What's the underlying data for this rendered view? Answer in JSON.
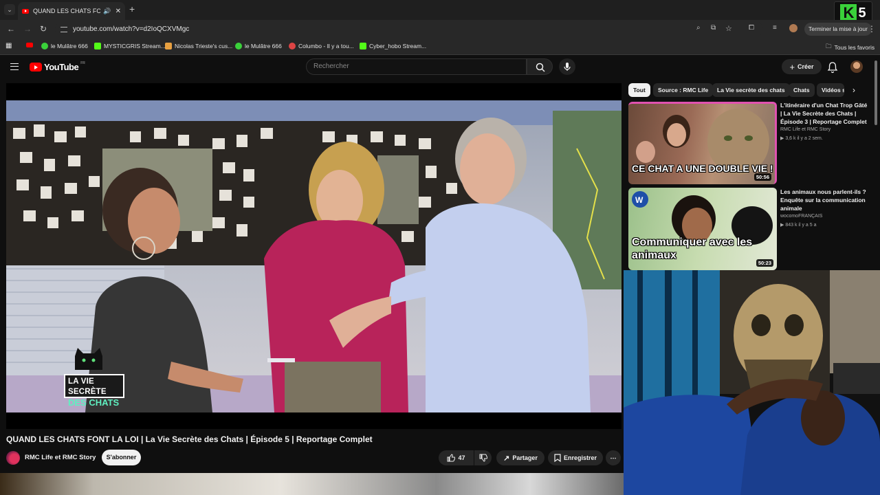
{
  "browser": {
    "tab_title": "QUAND LES CHATS FONT L",
    "url": "youtube.com/watch?v=d2IoQCXVMgc",
    "update_button": "Terminer la mise à jour",
    "bookmarks": [
      {
        "label": "le Mulâtre 666",
        "color": "#3ad13a"
      },
      {
        "label": "MYSTICGRIS Stream...",
        "color": "#53fc18"
      },
      {
        "label": "Nicolas Trieste's cus...",
        "color": "#e8a040"
      },
      {
        "label": "le Mulâtre 666",
        "color": "#3ad13a"
      },
      {
        "label": "Columbo - Il y a tou...",
        "color": "#d44"
      },
      {
        "label": "Cyber_hobo Stream...",
        "color": "#53fc18"
      }
    ],
    "all_bookmarks": "Tous les favoris"
  },
  "overlay_logo": {
    "number": "5"
  },
  "youtube": {
    "logo_text": "YouTube",
    "region": "FR",
    "search_placeholder": "Rechercher",
    "create_label": "Créer"
  },
  "video": {
    "title": "QUAND LES CHATS FONT LA LOI | La Vie Secrète des Chats | Épisode 5 | Reportage Complet",
    "badge_line1": "LA VIE SECRÈTE",
    "badge_line2": "DES CHATS",
    "channel": "RMC Life et RMC Story",
    "subscribe": "S'abonner",
    "likes": "47",
    "share": "Partager",
    "save": "Enregistrer"
  },
  "chips": [
    "Tout",
    "Source : RMC Life",
    "La Vie secrète des chats",
    "Chats",
    "Vidéos s"
  ],
  "related": [
    {
      "title": "L'itinéraire d'un Chat Trop Gâté | La Vie Secrète des Chats | Épisode 3 | Reportage Complet",
      "channel": "RMC Life et RMC Story",
      "meta": "3,6 k  il y a 2 sem.",
      "duration": "50:56",
      "overlay_text": "CE CHAT A UNE DOUBLE VIE !"
    },
    {
      "title": "Les animaux nous parlent-ils ? Enquête sur la communication animale",
      "channel": "wocomoFRANÇAIS",
      "meta": "843 k  il y a 5 a",
      "duration": "50:23",
      "overlay_text": "Communiquer avec les animaux"
    }
  ],
  "colors": {
    "background": "#0f0f0f",
    "youtube_red": "#ff0000",
    "chip_active": "#f1f1f1",
    "badge_accent": "#5ff0c0"
  }
}
